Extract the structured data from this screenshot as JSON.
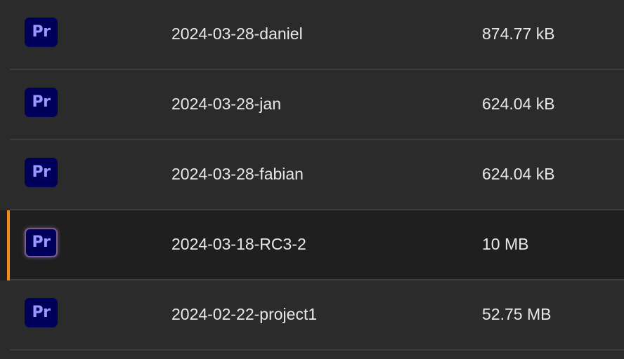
{
  "colors": {
    "background": "#2b2b2b",
    "selected_row_background": "#1f1f1f",
    "divider": "#3d3d3d",
    "accent": "#ef8a1b",
    "icon_background": "#00005b",
    "icon_text": "#9999ff",
    "text": "#e8e8e8"
  },
  "files": [
    {
      "icon": "premiere-pro-file-icon",
      "icon_label": "Pr",
      "name": "2024-03-28-daniel",
      "size": "874.77 kB",
      "selected": false
    },
    {
      "icon": "premiere-pro-file-icon",
      "icon_label": "Pr",
      "name": "2024-03-28-jan",
      "size": "624.04 kB",
      "selected": false
    },
    {
      "icon": "premiere-pro-file-icon",
      "icon_label": "Pr",
      "name": "2024-03-28-fabian",
      "size": "624.04 kB",
      "selected": false
    },
    {
      "icon": "premiere-pro-file-icon",
      "icon_label": "Pr",
      "name": "2024-03-18-RC3-2",
      "size": "10 MB",
      "selected": true
    },
    {
      "icon": "premiere-pro-file-icon",
      "icon_label": "Pr",
      "name": "2024-02-22-project1",
      "size": "52.75 MB",
      "selected": false
    }
  ]
}
